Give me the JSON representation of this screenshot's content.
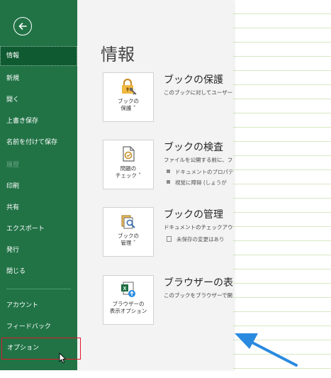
{
  "page": {
    "title": "情報"
  },
  "nav": {
    "items": [
      {
        "label": "情報",
        "state": "active"
      },
      {
        "label": "新規",
        "state": "normal"
      },
      {
        "label": "開く",
        "state": "normal"
      },
      {
        "label": "上書き保存",
        "state": "normal"
      },
      {
        "label": "名前を付けて保存",
        "state": "normal"
      },
      {
        "label": "履歴",
        "state": "disabled"
      },
      {
        "label": "印刷",
        "state": "normal"
      },
      {
        "label": "共有",
        "state": "normal"
      },
      {
        "label": "エクスポート",
        "state": "normal"
      },
      {
        "label": "発行",
        "state": "normal"
      },
      {
        "label": "閉じる",
        "state": "normal"
      },
      {
        "label": "アカウント",
        "state": "normal"
      },
      {
        "label": "フィードバック",
        "state": "normal"
      },
      {
        "label": "オプション",
        "state": "highlighted"
      }
    ]
  },
  "sections": {
    "protect": {
      "title": "ブックの保護",
      "desc": "このブックに対してユーザー",
      "tile_label": "ブックの\n保護 ˅",
      "icon": "lock-key-icon"
    },
    "inspect": {
      "title": "ブックの検査",
      "desc": "ファイルを公開する前に、フ",
      "bullets": [
        "ドキュメントのプロパテ",
        "視覚に障碍 (しょうが"
      ],
      "tile_label": "問題の\nチェック ˅",
      "icon": "document-check-icon"
    },
    "manage": {
      "title": "ブックの管理",
      "desc": "ドキュメントのチェックアウト",
      "bullets": [
        "未保存の変更はあり"
      ],
      "tile_label": "ブックの\n管理 ˅",
      "icon": "manage-workbook-icon"
    },
    "browser": {
      "title": "ブラウザーの表示",
      "desc": "このブックをブラウザーで開",
      "tile_label": "ブラウザーの\n表示オプション",
      "icon": "excel-browser-icon"
    }
  },
  "colors": {
    "sidebar": "#217346",
    "sidebar_active": "#0f5a30",
    "highlight_box": "#e0182a",
    "annotation_arrow": "#2a8ae0"
  }
}
